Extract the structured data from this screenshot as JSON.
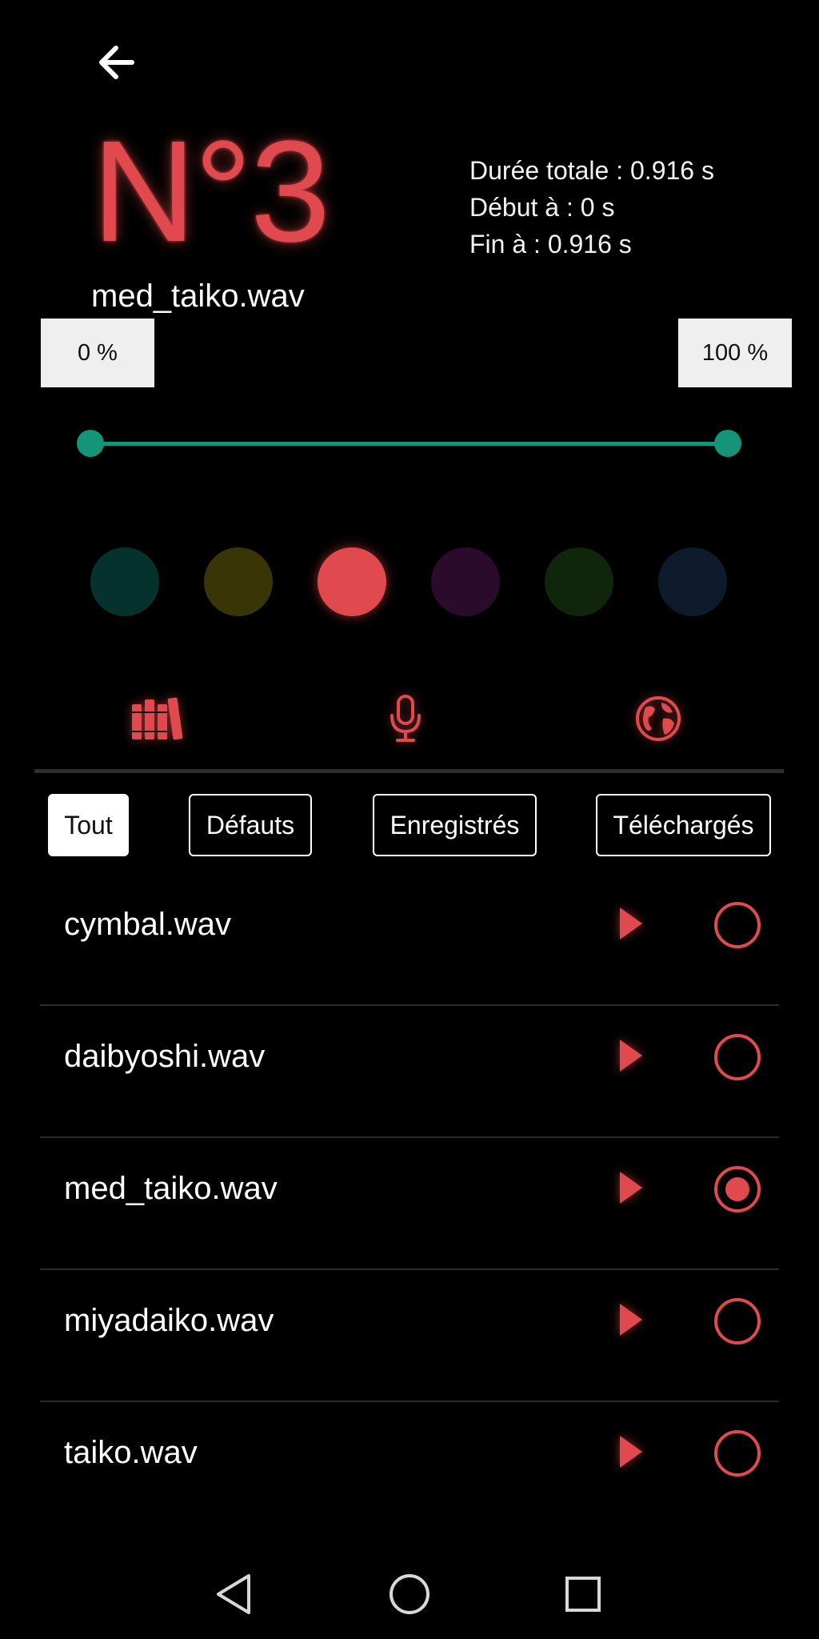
{
  "header": {
    "number": "N°3",
    "sound_name": "med_taiko.wav",
    "info": {
      "total_duration": "Durée totale : 0.916 s",
      "start": "Début à : 0 s",
      "end": "Fin à : 0.916 s"
    }
  },
  "trim": {
    "start_label": "0 %",
    "end_label": "100 %",
    "start_value_pct": 0,
    "end_value_pct": 100,
    "accent_color": "#149479"
  },
  "colors": {
    "options": [
      "#06322d",
      "#3a3506",
      "#e04a4f",
      "#2a0b2c",
      "#0f260b",
      "#0d1b2d"
    ],
    "selected_index": 2
  },
  "source_tabs": [
    {
      "icon": "library-icon",
      "selected": true
    },
    {
      "icon": "microphone-icon",
      "selected": false
    },
    {
      "icon": "globe-icon",
      "selected": false
    }
  ],
  "filters": [
    {
      "label": "Tout",
      "active": true
    },
    {
      "label": "Défauts",
      "active": false
    },
    {
      "label": "Enregistrés",
      "active": false
    },
    {
      "label": "Téléchargés",
      "active": false
    }
  ],
  "sounds": [
    {
      "name": "cymbal.wav",
      "selected": false
    },
    {
      "name": "daibyoshi.wav",
      "selected": false
    },
    {
      "name": "med_taiko.wav",
      "selected": true
    },
    {
      "name": "miyadaiko.wav",
      "selected": false
    },
    {
      "name": "taiko.wav",
      "selected": false
    }
  ],
  "theme": {
    "accent": "#e04a4f",
    "background": "#000000"
  },
  "system_nav": [
    "back-triangle-icon",
    "home-circle-icon",
    "recents-square-icon"
  ]
}
